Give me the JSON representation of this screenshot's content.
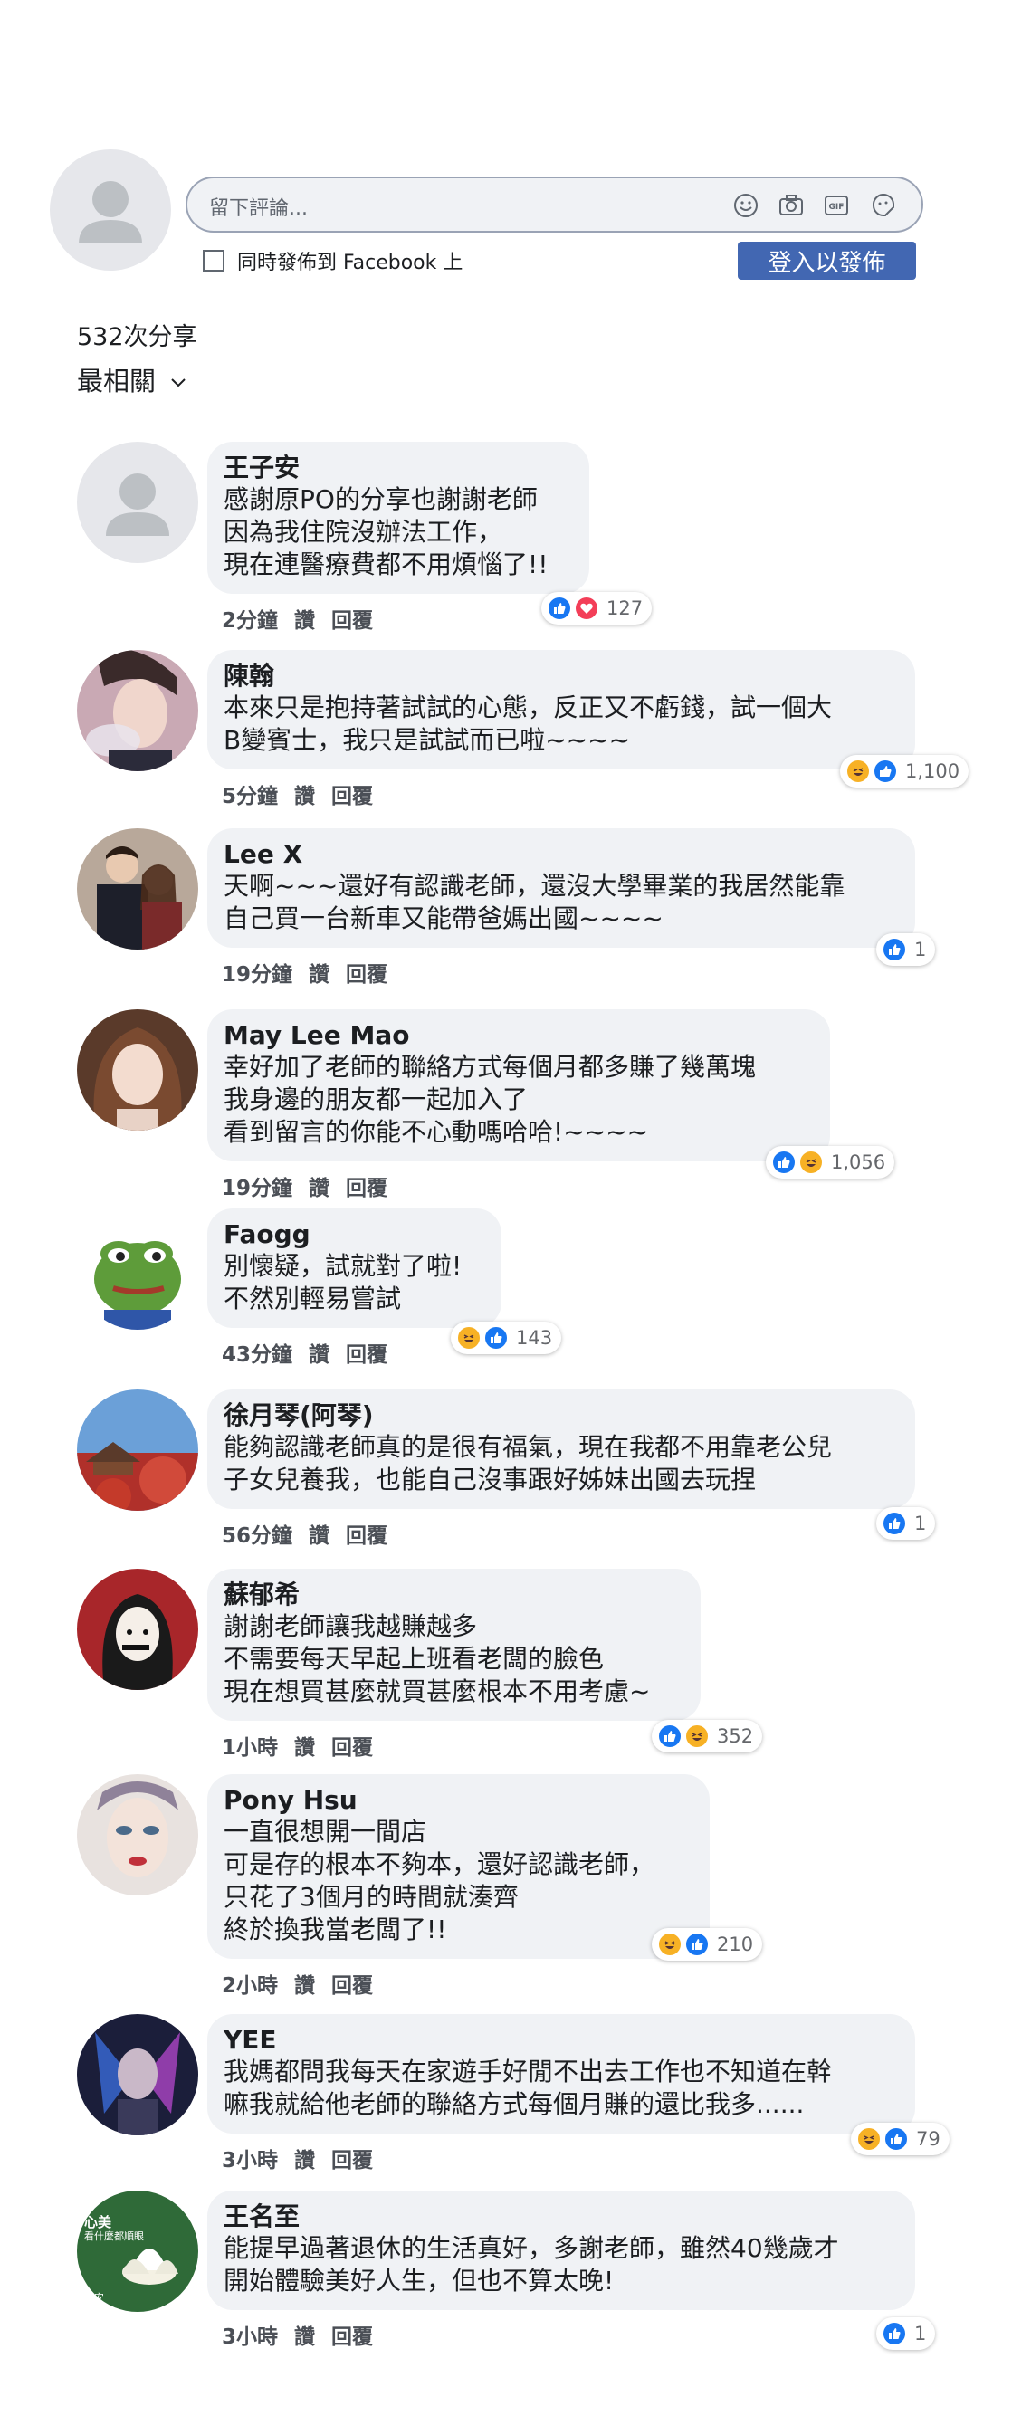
{
  "composer": {
    "placeholder": "留下評論...",
    "crosspost_label": "同時發佈到 Facebook 上",
    "login_button": "登入以發佈"
  },
  "summary": {
    "shares": "532次分享",
    "sort_label": "最相關"
  },
  "actions": {
    "like": "讚",
    "reply": "回覆"
  },
  "colors": {
    "bubble": "#f0f2f5",
    "like": "#1877f2",
    "love": "#f33e58",
    "haha": "#f7b125",
    "button": "#4267b2"
  },
  "comments": [
    {
      "name": "王子安",
      "lines": [
        "感謝原PO的分享也謝謝老師",
        "因為我住院沒辦法工作，",
        "現在連醫療費都不用煩惱了!!"
      ],
      "time": "2分鐘",
      "reactions": [
        "like",
        "love"
      ],
      "count": "127",
      "avatar": "default-avatar"
    },
    {
      "name": "陳翰",
      "lines": [
        "本來只是抱持著試試的心態，反正又不虧錢，試一個大",
        "B變賓士，我只是試試而已啦~~~~"
      ],
      "time": "5分鐘",
      "reactions": [
        "haha",
        "like"
      ],
      "count": "1,100",
      "avatar": "man-photo"
    },
    {
      "name": "Lee X",
      "lines": [
        "天啊~~~還好有認識老師，還沒大學畢業的我居然能靠",
        "自己買一台新車又能帶爸媽出國~~~~"
      ],
      "time": "19分鐘",
      "reactions": [
        "like"
      ],
      "count": "1",
      "avatar": "couple-photo"
    },
    {
      "name": "May Lee Mao",
      "lines": [
        "幸好加了老師的聯絡方式每個月都多賺了幾萬塊",
        "我身邊的朋友都一起加入了",
        "看到留言的你能不心動嗎哈哈!~~~~"
      ],
      "time": "19分鐘",
      "reactions": [
        "like",
        "haha"
      ],
      "count": "1,056",
      "avatar": "woman-photo"
    },
    {
      "name": "Faogg",
      "lines": [
        "別懷疑，試就對了啦!",
        "不然別輕易嘗試"
      ],
      "time": "43分鐘",
      "reactions": [
        "haha",
        "like"
      ],
      "count": "143",
      "avatar": "frog-avatar"
    },
    {
      "name": "徐月琴(阿琴)",
      "lines": [
        "能夠認識老師真的是很有福氣，現在我都不用靠老公兒",
        "子女兒養我，也能自己沒事跟好姊妹出國去玩捏"
      ],
      "time": "56分鐘",
      "reactions": [
        "like"
      ],
      "count": "1",
      "avatar": "temple-photo"
    },
    {
      "name": "蘇郁希",
      "lines": [
        "謝謝老師讓我越賺越多",
        "不需要每天早起上班看老闆的臉色",
        "現在想買甚麼就買甚麼根本不用考慮~"
      ],
      "time": "1小時",
      "reactions": [
        "like",
        "haha"
      ],
      "count": "352",
      "avatar": "illustration-avatar"
    },
    {
      "name": "Pony Hsu",
      "lines": [
        "一直很想開一間店",
        "可是存的根本不夠本，還好認識老師，",
        "只花了3個月的時間就湊齊",
        "終於換我當老闆了!!"
      ],
      "time": "2小時",
      "reactions": [
        "haha",
        "like"
      ],
      "count": "210",
      "avatar": "portrait-painting"
    },
    {
      "name": "YEE",
      "lines": [
        "我媽都問我每天在家遊手好閒不出去工作也不知道在幹",
        "嘛我就給他老師的聯絡方式每個月賺的還比我多......"
      ],
      "time": "3小時",
      "reactions": [
        "haha",
        "like"
      ],
      "count": "79",
      "avatar": "game-character"
    },
    {
      "name": "王名至",
      "lines": [
        "能提早過著退休的生活真好，多謝老師，雖然40幾歲才",
        "開始體驗美好人生，但也不算太晚!"
      ],
      "time": "3小時",
      "reactions": [
        "like"
      ],
      "count": "1",
      "avatar": "lotus-avatar",
      "avatar_text": [
        "心美",
        "看什麼都順眼",
        "早安"
      ]
    }
  ]
}
